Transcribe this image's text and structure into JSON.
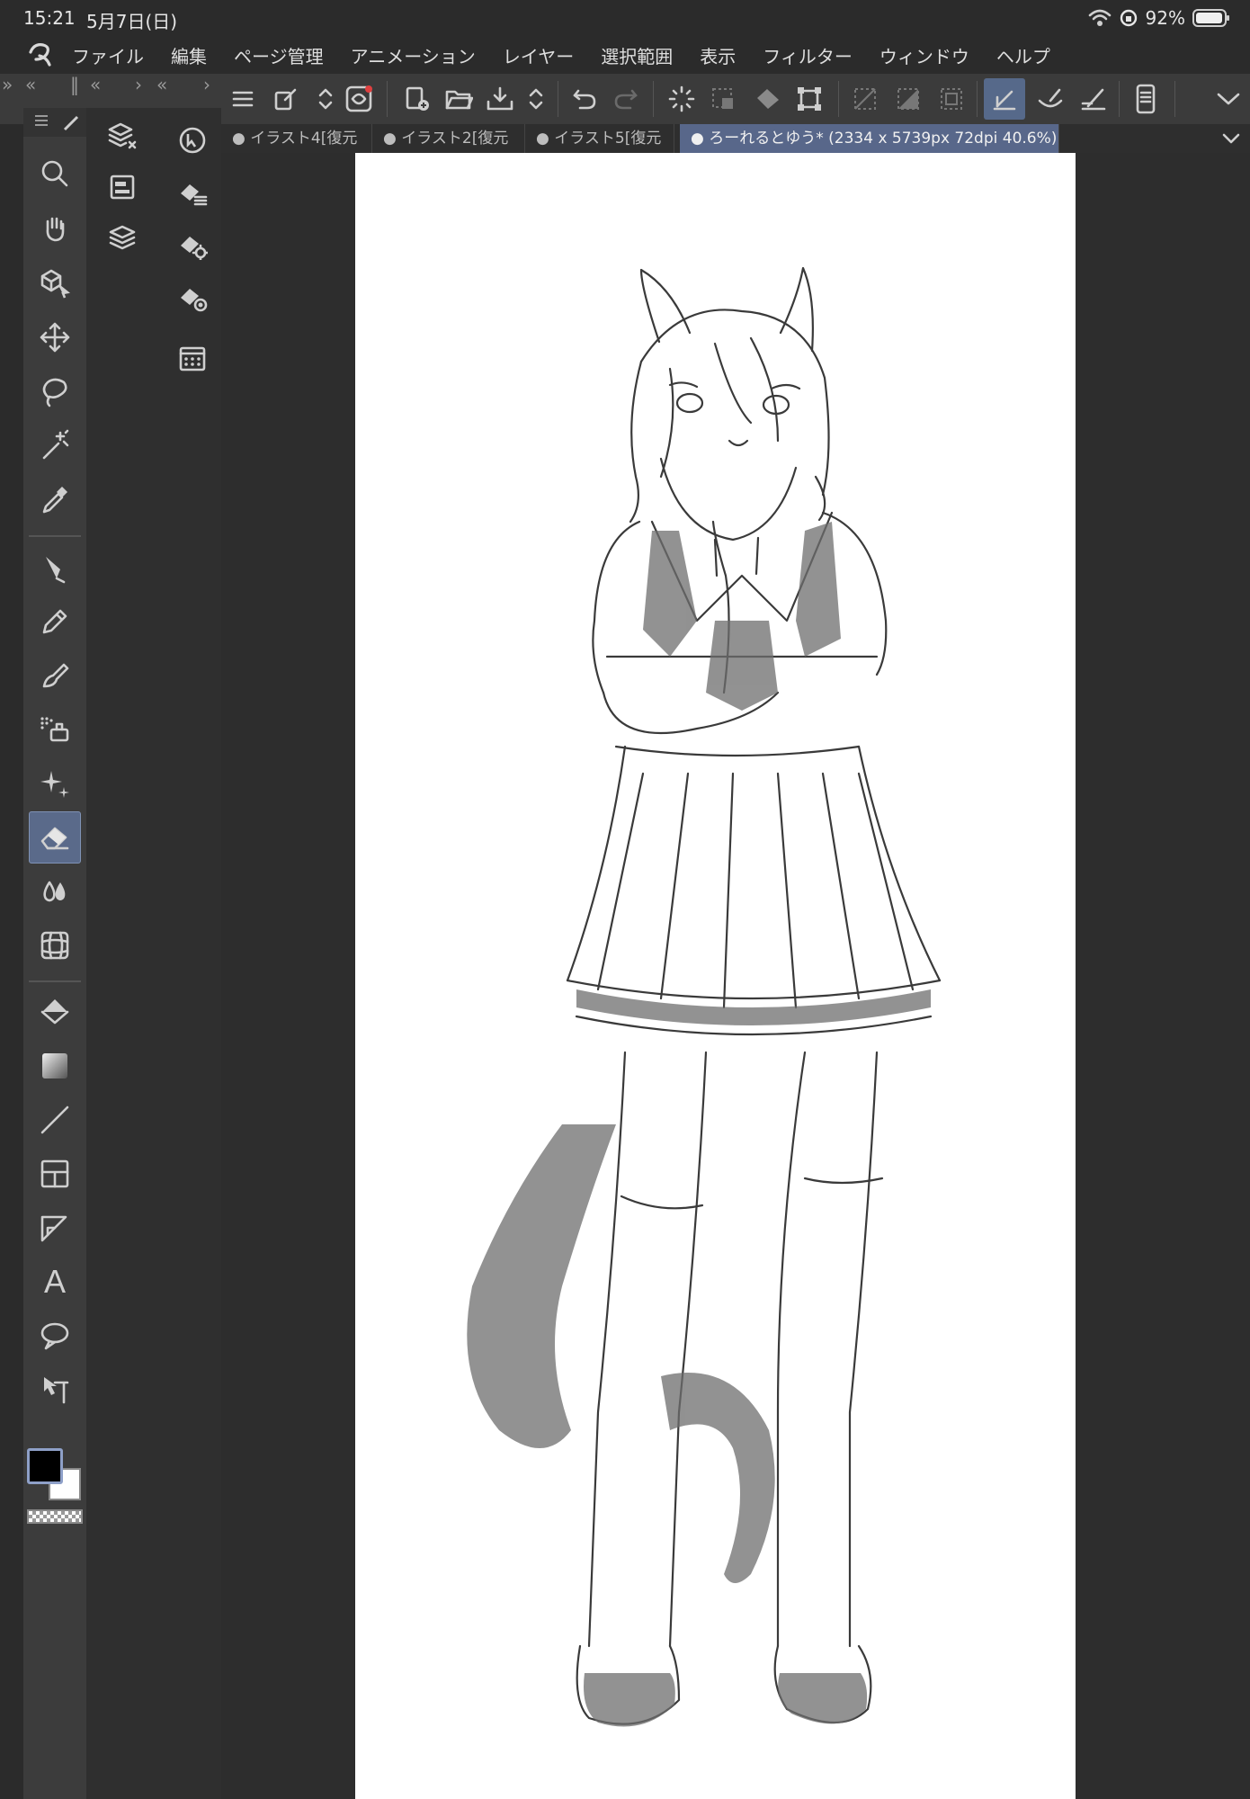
{
  "status": {
    "time": "15:21",
    "date": "5月7日(日)",
    "battery": "92%"
  },
  "menu": {
    "items": [
      "ファイル",
      "編集",
      "ページ管理",
      "アニメーション",
      "レイヤー",
      "選択範囲",
      "表示",
      "フィルター",
      "ウィンドウ",
      "ヘルプ"
    ]
  },
  "panel_header": {
    "collapse_left": "»",
    "collapse_left2": "«",
    "sep": "‖",
    "collapse_mid": "«",
    "expand": "›",
    "collapse_right": "«",
    "expand_right": "›"
  },
  "tabs": [
    {
      "label": "● イラスト4[復元"
    },
    {
      "label": "● イラスト2[復元"
    },
    {
      "label": "● イラスト5[復元"
    },
    {
      "label": "● ろーれるとゆう* (2334 x 5739px 72dpi 40.6%)"
    }
  ],
  "tools": [
    {
      "name": "zoom-icon"
    },
    {
      "name": "hand-icon"
    },
    {
      "name": "object-select-icon"
    },
    {
      "name": "move-icon"
    },
    {
      "name": "lasso-icon"
    },
    {
      "name": "magic-wand-icon"
    },
    {
      "name": "eyedropper-icon"
    },
    {
      "name": "pen-icon"
    },
    {
      "name": "pencil-icon"
    },
    {
      "name": "brush-icon"
    },
    {
      "name": "airbrush-icon"
    },
    {
      "name": "decoration-icon"
    },
    {
      "name": "eraser-icon"
    },
    {
      "name": "blend-icon"
    },
    {
      "name": "liquify-icon"
    },
    {
      "name": "fill-icon"
    },
    {
      "name": "gradient-icon"
    },
    {
      "name": "line-icon"
    },
    {
      "name": "frame-icon"
    },
    {
      "name": "ruler-icon"
    },
    {
      "name": "text-icon"
    },
    {
      "name": "balloon-icon"
    },
    {
      "name": "correct-line-icon"
    }
  ],
  "text_tool_label": "A",
  "colors": {
    "main": "#000000",
    "sub": "#ffffff",
    "accent": "#5a6a8a"
  }
}
